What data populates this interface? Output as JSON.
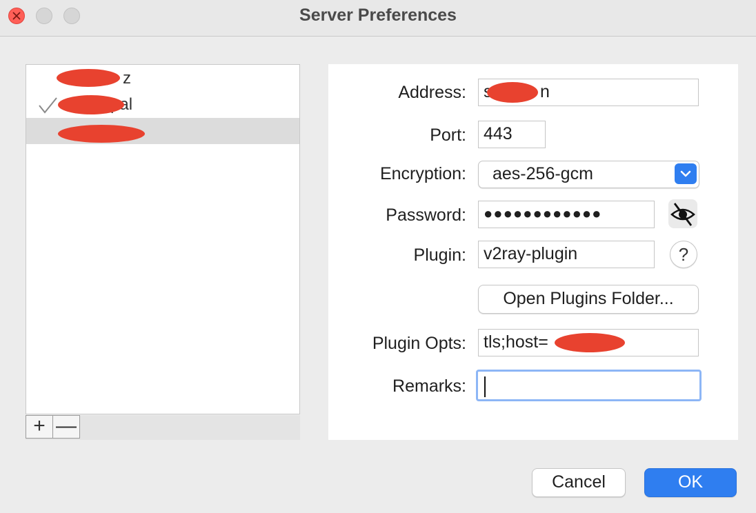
{
  "window": {
    "title": "Server Preferences"
  },
  "server_list": {
    "items": [
      {
        "name": "z",
        "active": false,
        "selected": false
      },
      {
        "name": "pal",
        "active": true,
        "selected": false
      },
      {
        "name": "",
        "active": false,
        "selected": true
      }
    ],
    "add_label": "+",
    "remove_label": "—"
  },
  "form": {
    "address_label": "Address:",
    "address_value": "s          n",
    "port_label": "Port:",
    "port_value": "443",
    "encryption_label": "Encryption:",
    "encryption_value": "aes-256-gcm",
    "password_label": "Password:",
    "password_value": "●●●●●●●●●●●●",
    "plugin_label": "Plugin:",
    "plugin_value": "v2ray-plugin",
    "plugin_help": "?",
    "open_plugins_label": "Open Plugins Folder...",
    "plugin_opts_label": "Plugin Opts:",
    "plugin_opts_value": "tls;host=            ;",
    "remarks_label": "Remarks:",
    "remarks_value": ""
  },
  "footer": {
    "cancel_label": "Cancel",
    "ok_label": "OK"
  },
  "colors": {
    "accent": "#2f7ef0",
    "redaction": "#e8422f",
    "close": "#ff5f57"
  }
}
